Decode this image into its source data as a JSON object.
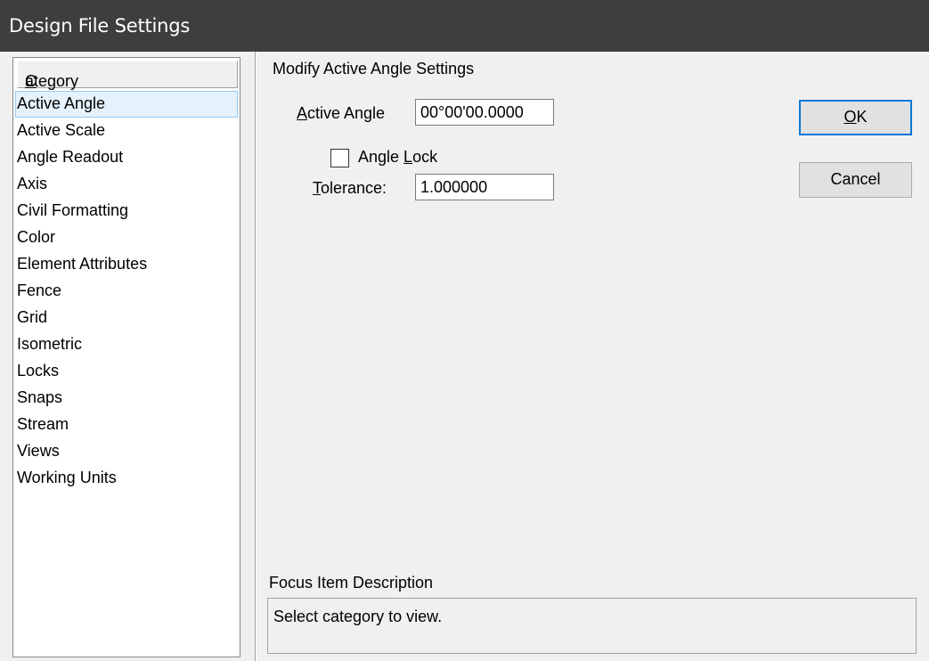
{
  "window": {
    "title": "Design File Settings"
  },
  "category_list": {
    "header": "Category",
    "header_first": "C",
    "header_rest": "ategory",
    "selected_index": 0,
    "items": [
      "Active Angle",
      "Active Scale",
      "Angle Readout",
      "Axis",
      "Civil Formatting",
      "Color",
      "Element Attributes",
      "Fence",
      "Grid",
      "Isometric",
      "Locks",
      "Snaps",
      "Stream",
      "Views",
      "Working Units"
    ]
  },
  "settings": {
    "section_title": "Modify Active Angle Settings",
    "active_angle_label": "Active Angle",
    "active_angle_label_first": "A",
    "active_angle_label_rest": "ctive Angle",
    "active_angle_value": "00°00'00.0000",
    "angle_lock_label": "Angle Lock",
    "angle_lock_label_pre": "Angle ",
    "angle_lock_label_u": "L",
    "angle_lock_label_post": "ock",
    "angle_lock_checked": false,
    "tolerance_label": "Tolerance:",
    "tolerance_label_first": "T",
    "tolerance_label_rest": "olerance:",
    "tolerance_value": "1.000000"
  },
  "buttons": {
    "ok": "OK",
    "ok_first": "O",
    "ok_rest": "K",
    "cancel": "Cancel"
  },
  "focus": {
    "label": "Focus Item Description",
    "text": "Select category to view."
  },
  "colors": {
    "titlebar": "#3e3e3e",
    "selection": "#e5f1fb",
    "default_button_border": "#0078d7"
  }
}
